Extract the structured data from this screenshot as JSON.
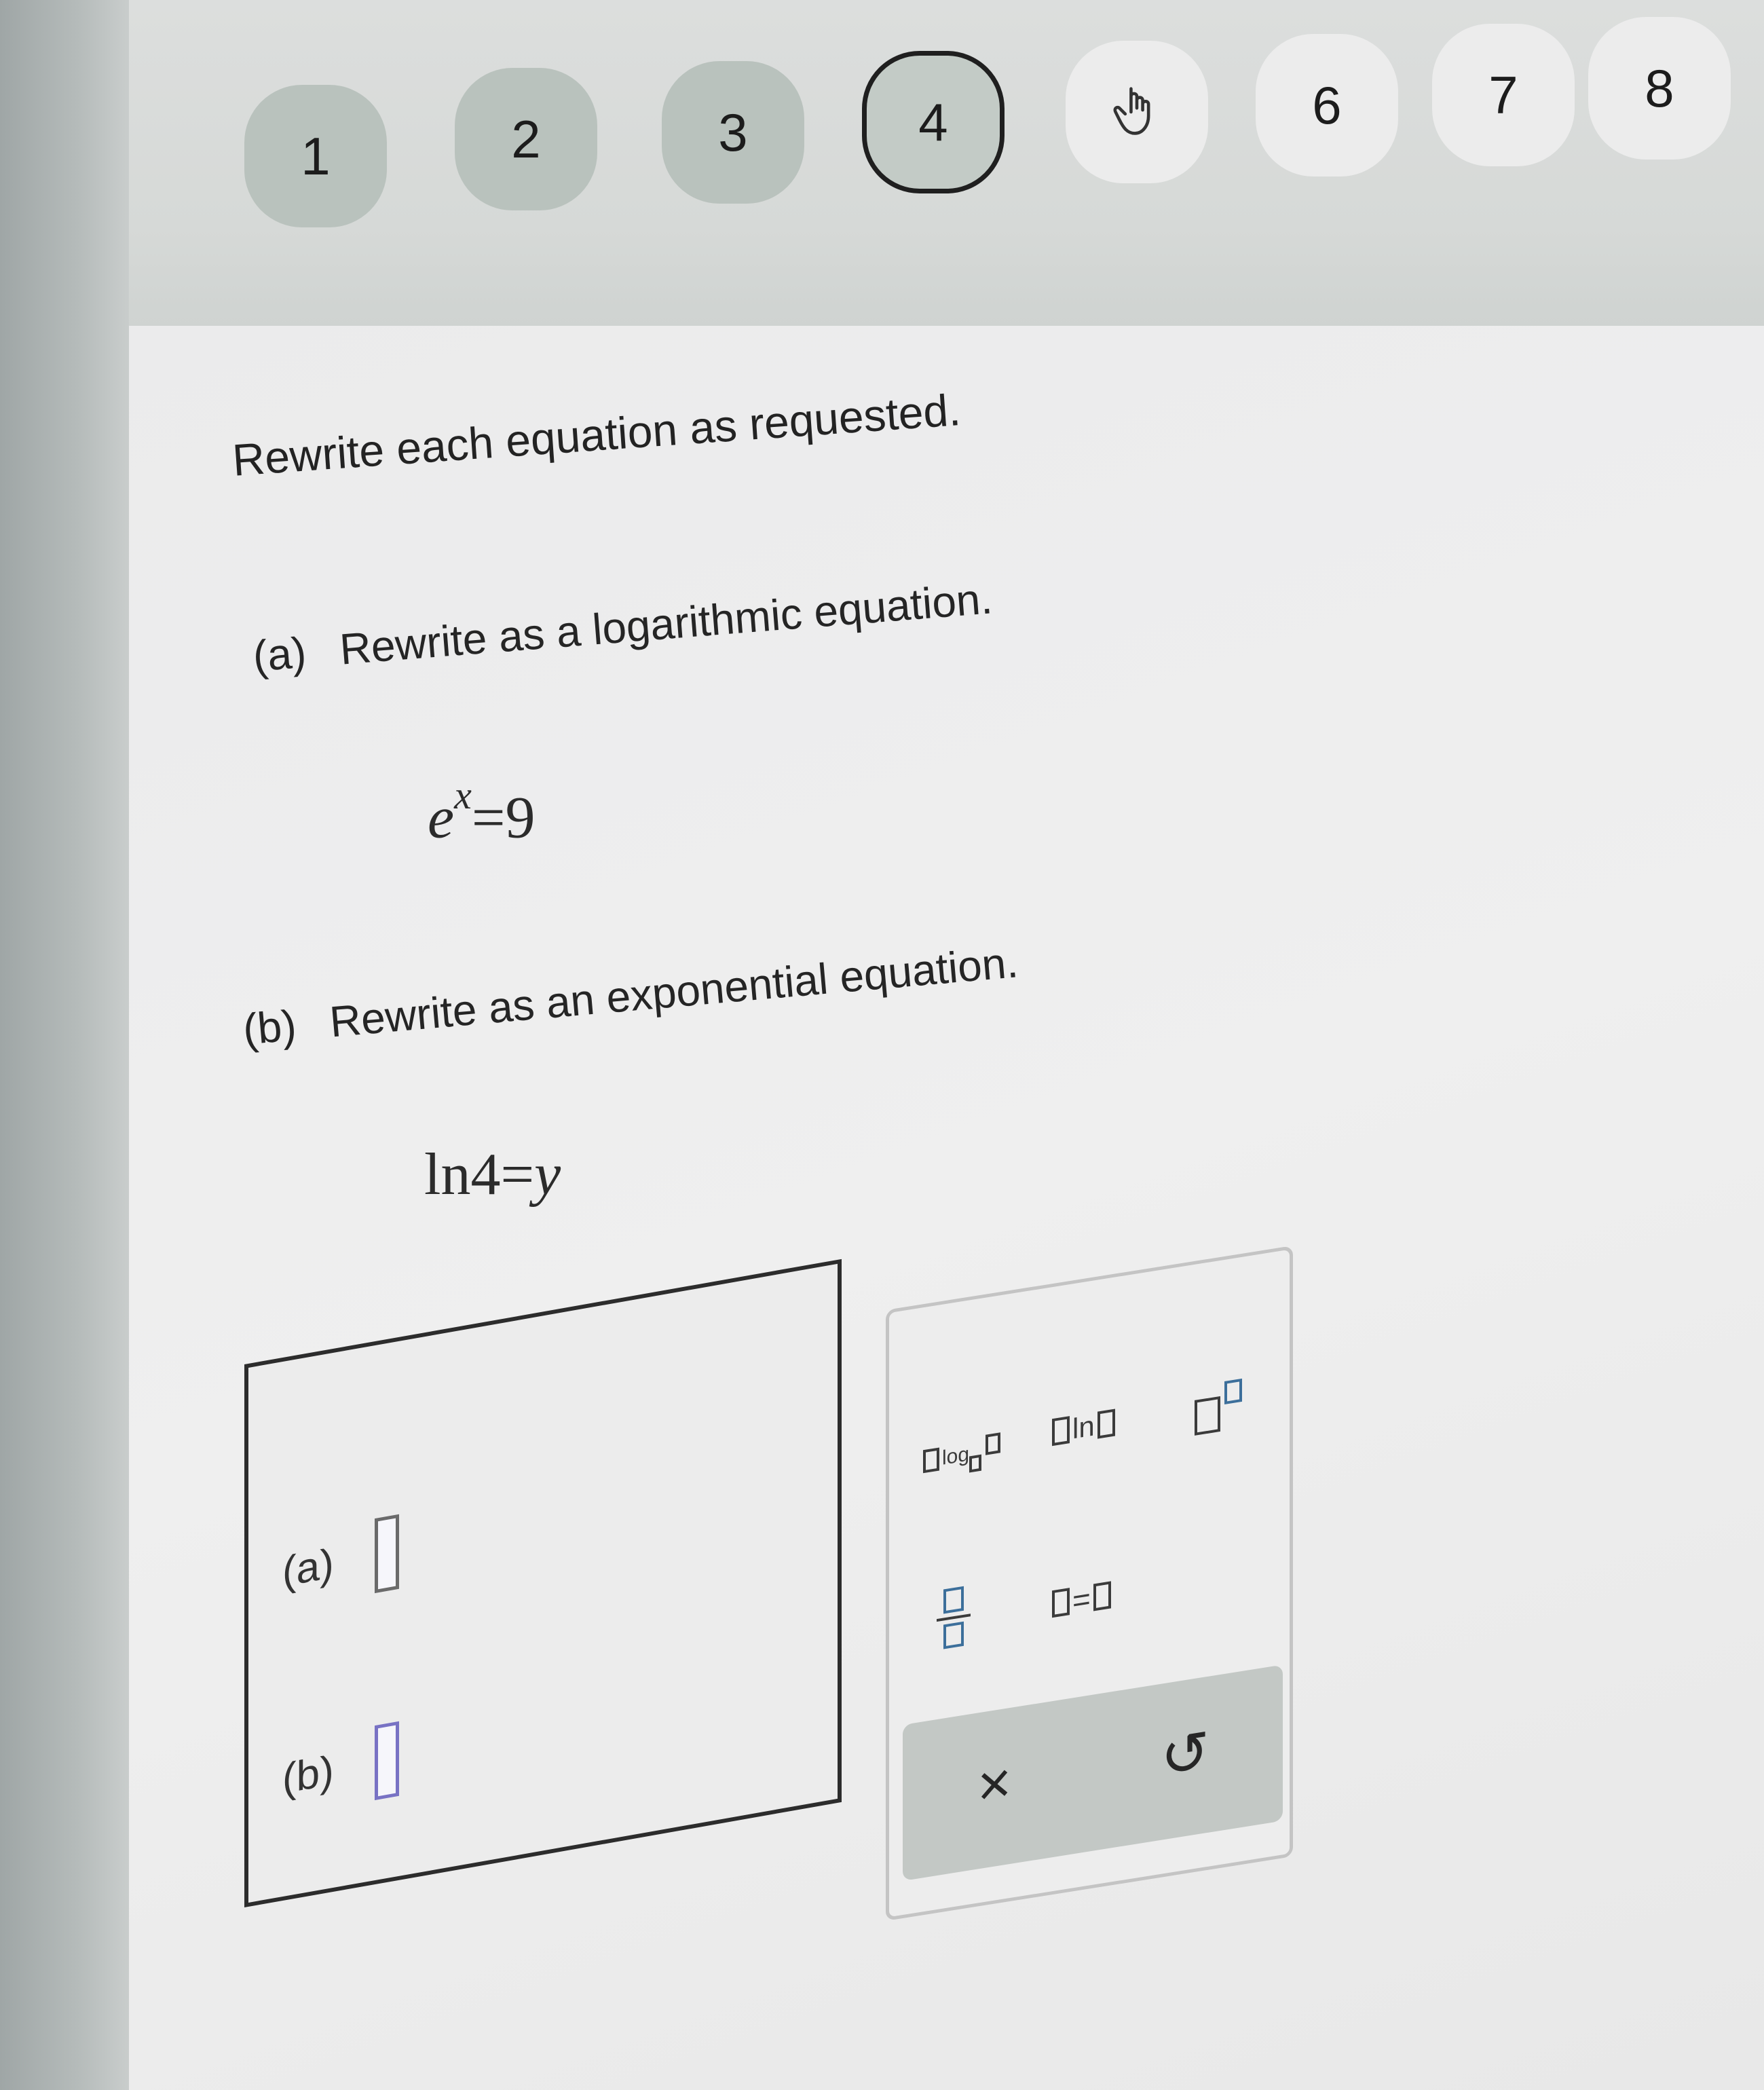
{
  "question_nav": {
    "items": [
      {
        "label": "1",
        "state": "done"
      },
      {
        "label": "2",
        "state": "done"
      },
      {
        "label": "3",
        "state": "done"
      },
      {
        "label": "4",
        "state": "current"
      },
      {
        "label": "",
        "state": "todo",
        "icon": "hand-pointer-icon"
      },
      {
        "label": "6",
        "state": "todo"
      },
      {
        "label": "7",
        "state": "todo"
      },
      {
        "label": "8",
        "state": "todo"
      }
    ]
  },
  "problem": {
    "instructions": "Rewrite each equation as requested.",
    "part_a": {
      "label": "(a)",
      "prompt": "Rewrite as a logarithmic equation.",
      "eq_base": "e",
      "eq_exp": "x",
      "eq_rest": "=9"
    },
    "part_b": {
      "label": "(b)",
      "prompt": "Rewrite as an exponential equation.",
      "eq_ln": "ln",
      "eq_num": "4",
      "eq_eq": "=",
      "eq_var": "y"
    }
  },
  "answer": {
    "a_label": "(a)",
    "b_label": "(b)"
  },
  "keypad": {
    "log_text": "log",
    "ln_text": "ln",
    "equals_text": "=",
    "clear_symbol": "×",
    "undo_symbol": "↺"
  },
  "colors": {
    "done": "#b9c2bd",
    "current_border": "#1f1f1f",
    "slot": "#7872c4"
  }
}
